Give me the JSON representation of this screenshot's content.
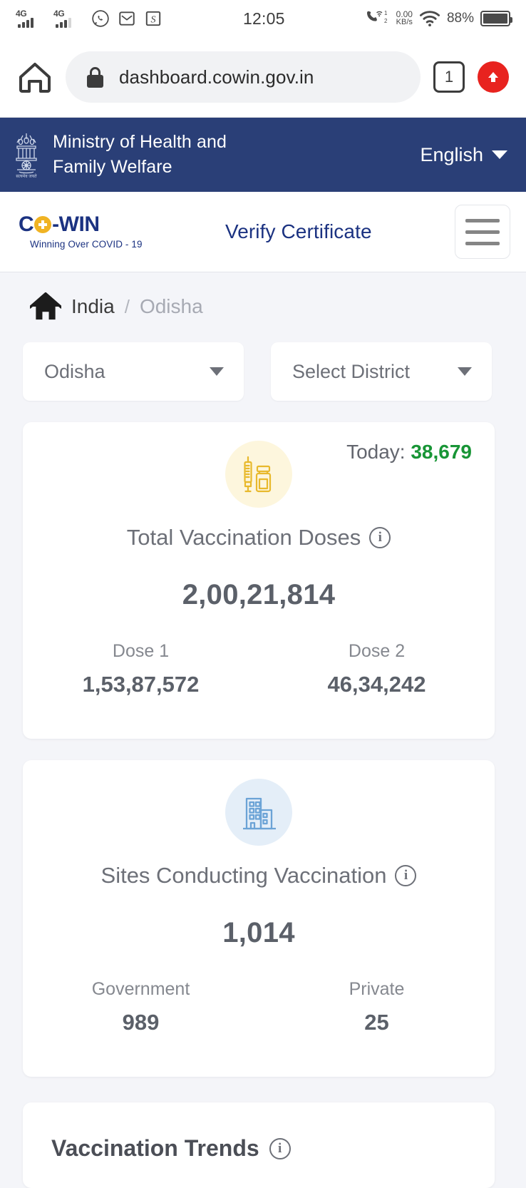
{
  "status_bar": {
    "network_1": "4G",
    "network_2": "4G",
    "time": "12:05",
    "sim_badge_1": "1",
    "sim_badge_2": "2",
    "data_rate_value": "0.00",
    "data_rate_unit": "KB/s",
    "battery_percent": "88%",
    "icons": [
      "whatsapp-icon",
      "mail-icon",
      "app-icon"
    ]
  },
  "browser": {
    "url": "dashboard.cowin.gov.in",
    "tab_count": "1"
  },
  "ministry_header": {
    "line1": "Ministry of Health and",
    "line2": "Family Welfare",
    "language": "English"
  },
  "navbar": {
    "logo_c": "C",
    "logo_rest": "-WIN",
    "logo_tagline": "Winning Over COVID - 19",
    "verify_label": "Verify Certificate"
  },
  "breadcrumb": {
    "root": "India",
    "separator": "/",
    "current": "Odisha"
  },
  "filters": {
    "state": "Odisha",
    "district": "Select District"
  },
  "cards": [
    {
      "today_label": "Today:",
      "today_value": "38,679",
      "title": "Total Vaccination Doses",
      "total": "2,00,21,814",
      "left_label": "Dose 1",
      "left_value": "1,53,87,572",
      "right_label": "Dose 2",
      "right_value": "46,34,242"
    },
    {
      "title": "Sites Conducting Vaccination",
      "total": "1,014",
      "left_label": "Government",
      "left_value": "989",
      "right_label": "Private",
      "right_value": "25"
    }
  ],
  "trends": {
    "title": "Vaccination Trends"
  },
  "colors": {
    "header_navy": "#2a3f77",
    "brand_navy": "#1b3281",
    "accent_gold": "#f0b323",
    "today_green": "#189536",
    "page_bg": "#f4f5f9"
  }
}
